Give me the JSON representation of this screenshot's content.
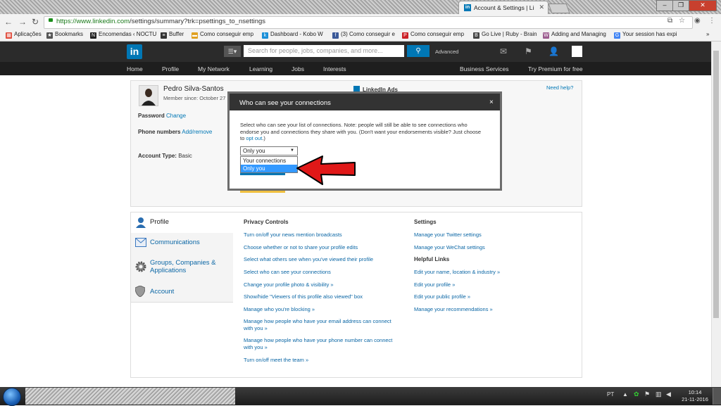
{
  "browser": {
    "tab_title": "Account & Settings | LinkedIn",
    "url_host": "https://www.linkedin.com",
    "url_path": "/settings/summary?trk=psettings_to_nsettings",
    "bookmarks": [
      {
        "label": "Aplicações",
        "icon": "apps-icon",
        "color": "#e04a3a"
      },
      {
        "label": "Bookmarks",
        "icon": "star-icon",
        "color": "#555555"
      },
      {
        "label": "Encomendas ‹ NOCTU",
        "icon": "notion-icon",
        "color": "#222222"
      },
      {
        "label": "Buffer",
        "icon": "buffer-icon",
        "color": "#333333"
      },
      {
        "label": "Como conseguir emp",
        "icon": "folder-icon",
        "color": "#e0a020"
      },
      {
        "label": "Dashboard - Kobo W",
        "icon": "kobo-icon",
        "color": "#1a8fd8"
      },
      {
        "label": "(3) Como conseguir e",
        "icon": "facebook-icon",
        "color": "#3b5998"
      },
      {
        "label": "Como conseguir emp",
        "icon": "pinterest-icon",
        "color": "#cb2027"
      },
      {
        "label": "Go Live | Ruby - Brain",
        "icon": "b-icon",
        "color": "#444444"
      },
      {
        "label": "Adding and Managing",
        "icon": "woocommerce-icon",
        "color": "#9b5c8f"
      },
      {
        "label": "Your session has expi",
        "icon": "google-icon",
        "color": "#4285f4"
      }
    ],
    "more_bookmarks": "»"
  },
  "linkedin": {
    "logo": "in",
    "search_placeholder": "Search for people, jobs, companies, and more...",
    "advanced": "Advanced",
    "nav": [
      "Home",
      "Profile",
      "My Network",
      "Learning",
      "Jobs",
      "Interests"
    ],
    "nav_right": [
      "Business Services",
      "Try Premium for free"
    ],
    "brand_color": "#0077b5"
  },
  "account": {
    "name": "Pedro Silva-Santos",
    "member_since": "Member since: October 27",
    "password_label": "Password",
    "password_link": "Change",
    "phone_label": "Phone numbers",
    "phone_link": "Add/remove",
    "type_label": "Account Type:",
    "type_value": "Basic",
    "need_help": "Need help?",
    "linkedin_ads": "LinkedIn Ads"
  },
  "modal": {
    "title": "Who can see your connections",
    "close": "×",
    "text_before_link": "Select who can see your list of connections. Note: people will still be able to see connections who endorse you and connections they share with you. (Don't want your endorsements visible? Just choose to ",
    "opt_out_link": "opt out",
    "text_after_link": ".)",
    "select_value": "Only you",
    "options": [
      "Your connections",
      "Only you"
    ],
    "selected_option": "Only you"
  },
  "settings": {
    "sidebar": [
      {
        "label": "Profile",
        "icon": "person-icon"
      },
      {
        "label": "Communications",
        "icon": "envelope-icon"
      },
      {
        "label": "Groups, Companies & Applications",
        "icon": "gear-icon"
      },
      {
        "label": "Account",
        "icon": "shield-icon"
      }
    ],
    "privacy_heading": "Privacy Controls",
    "privacy_links": [
      "Turn on/off your news mention broadcasts",
      "Choose whether or not to share your profile edits",
      "Select what others see when you've viewed their profile",
      "Select who can see your connections",
      "Change your profile photo & visibility »",
      "Show/hide \"Viewers of this profile also viewed\" box",
      "Manage who you're blocking »",
      "Manage how people who have your email address can connect with you »",
      "Manage how people who have your phone number can connect with you »",
      "Turn on/off meet the team »"
    ],
    "settings_heading": "Settings",
    "settings_links": [
      "Manage your Twitter settings",
      "Manage your WeChat settings"
    ],
    "helpful_heading": "Helpful Links",
    "helpful_links": [
      "Edit your name, location & industry »",
      "Edit your profile »",
      "Edit your public profile »",
      "Manage your recommendations »"
    ]
  },
  "taskbar": {
    "lang": "PT",
    "time": "10:14",
    "date": "21-11-2016"
  }
}
